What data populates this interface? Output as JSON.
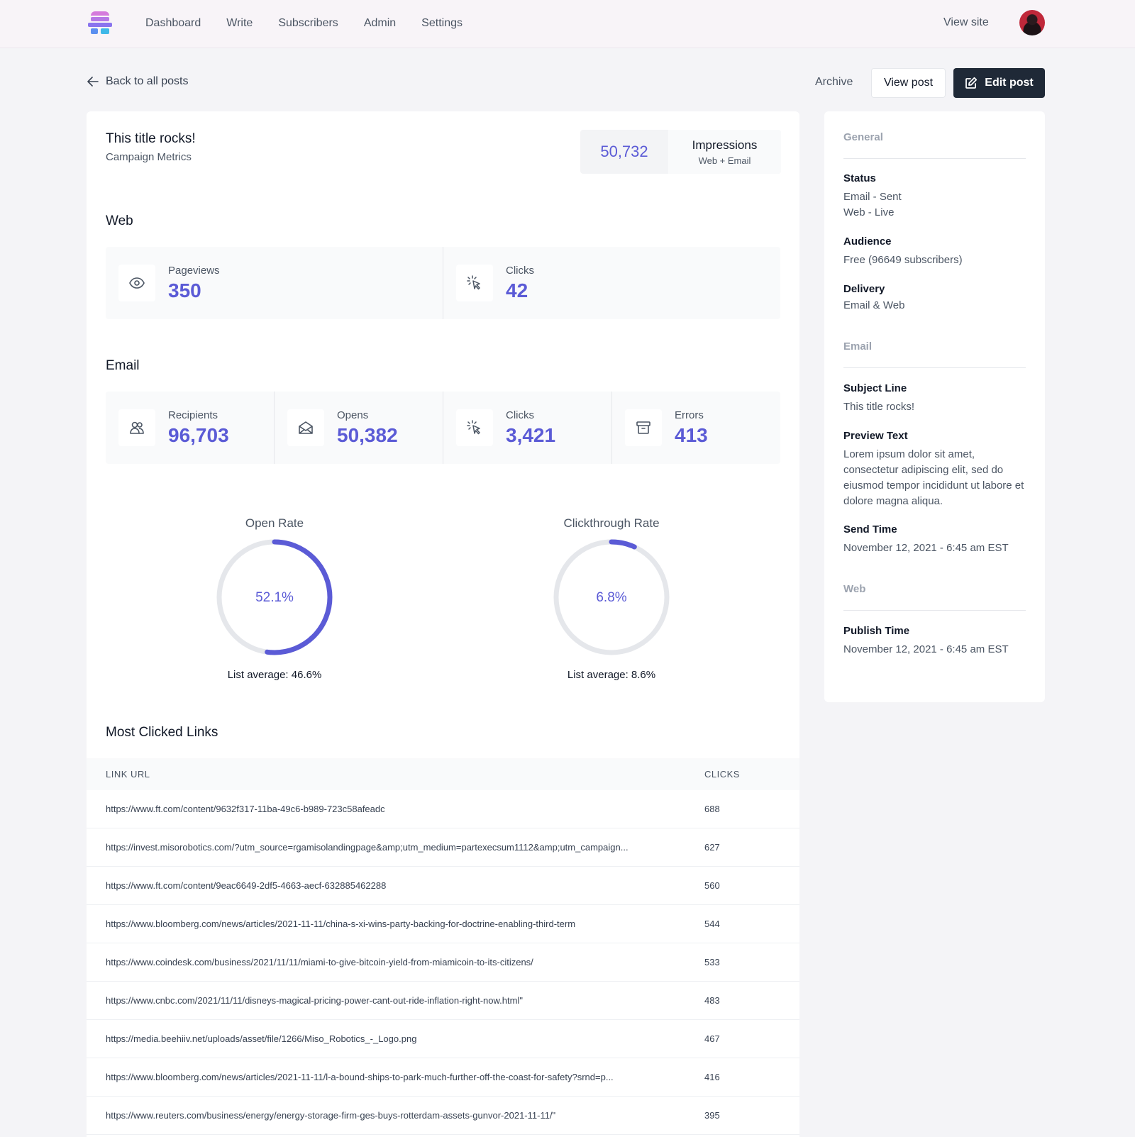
{
  "nav": {
    "links": [
      "Dashboard",
      "Write",
      "Subscribers",
      "Admin",
      "Settings"
    ],
    "view_site": "View site"
  },
  "header": {
    "back": "Back to all posts",
    "archive": "Archive",
    "view_post": "View post",
    "edit_post": "Edit post"
  },
  "post": {
    "title": "This title rocks!",
    "subtitle": "Campaign Metrics",
    "impressions_value": "50,732",
    "impressions_label": "Impressions",
    "impressions_sub": "Web + Email"
  },
  "web": {
    "title": "Web",
    "stats": [
      {
        "label": "Pageviews",
        "value": "350",
        "icon": "eye-icon"
      },
      {
        "label": "Clicks",
        "value": "42",
        "icon": "cursor-click-icon"
      }
    ]
  },
  "email": {
    "title": "Email",
    "stats": [
      {
        "label": "Recipients",
        "value": "96,703",
        "icon": "users-icon"
      },
      {
        "label": "Opens",
        "value": "50,382",
        "icon": "envelope-open-icon"
      },
      {
        "label": "Clicks",
        "value": "3,421",
        "icon": "cursor-click-icon"
      },
      {
        "label": "Errors",
        "value": "413",
        "icon": "archive-box-icon"
      }
    ]
  },
  "gauges": [
    {
      "title": "Open Rate",
      "value_text": "52.1%",
      "fraction": 0.521,
      "avg": "List average: 46.6%"
    },
    {
      "title": "Clickthrough Rate",
      "value_text": "6.8%",
      "fraction": 0.068,
      "avg": "List average: 8.6%"
    }
  ],
  "links": {
    "title": "Most Clicked Links",
    "col_url": "LINK URL",
    "col_clicks": "CLICKS",
    "rows": [
      {
        "url": "https://www.ft.com/content/9632f317-11ba-49c6-b989-723c58afeadc",
        "clicks": "688"
      },
      {
        "url": "https://invest.misorobotics.com/?utm_source=rgamisolandingpage&amp;utm_medium=partexecsum1112&amp;utm_campaign...",
        "clicks": "627"
      },
      {
        "url": "https://www.ft.com/content/9eac6649-2df5-4663-aecf-632885462288",
        "clicks": "560"
      },
      {
        "url": "https://www.bloomberg.com/news/articles/2021-11-11/china-s-xi-wins-party-backing-for-doctrine-enabling-third-term",
        "clicks": "544"
      },
      {
        "url": "https://www.coindesk.com/business/2021/11/11/miami-to-give-bitcoin-yield-from-miamicoin-to-its-citizens/",
        "clicks": "533"
      },
      {
        "url": "https://www.cnbc.com/2021/11/11/disneys-magical-pricing-power-cant-out-ride-inflation-right-now.html\"",
        "clicks": "483"
      },
      {
        "url": "https://media.beehiiv.net/uploads/asset/file/1266/Miso_Robotics_-_Logo.png",
        "clicks": "467"
      },
      {
        "url": "https://www.bloomberg.com/news/articles/2021-11-11/l-a-bound-ships-to-park-much-further-off-the-coast-for-safety?srnd=p...",
        "clicks": "416"
      },
      {
        "url": "https://www.reuters.com/business/energy/energy-storage-firm-ges-buys-rotterdam-assets-gunvor-2021-11-11/\"",
        "clicks": "395"
      }
    ]
  },
  "sidebar": {
    "general": "General",
    "status_label": "Status",
    "status_email": "Email - Sent",
    "status_web": "Web - Live",
    "audience_label": "Audience",
    "audience_value": "Free (96649 subscribers)",
    "delivery_label": "Delivery",
    "delivery_value": "Email & Web",
    "email": "Email",
    "subject_label": "Subject Line",
    "subject_value": "This title rocks!",
    "preview_label": "Preview Text",
    "preview_value": "Lorem ipsum dolor sit amet, consectetur adipiscing elit, sed do eiusmod tempor incididunt ut labore et dolore magna aliqua.",
    "send_label": "Send Time",
    "send_value": "November 12, 2021 - 6:45 am EST",
    "web": "Web",
    "publish_label": "Publish Time",
    "publish_value": "November 12, 2021 - 6:45 am EST"
  },
  "colors": {
    "accent": "#5b5bd6",
    "track": "#e5e7eb",
    "dark_button": "#1f2937"
  }
}
